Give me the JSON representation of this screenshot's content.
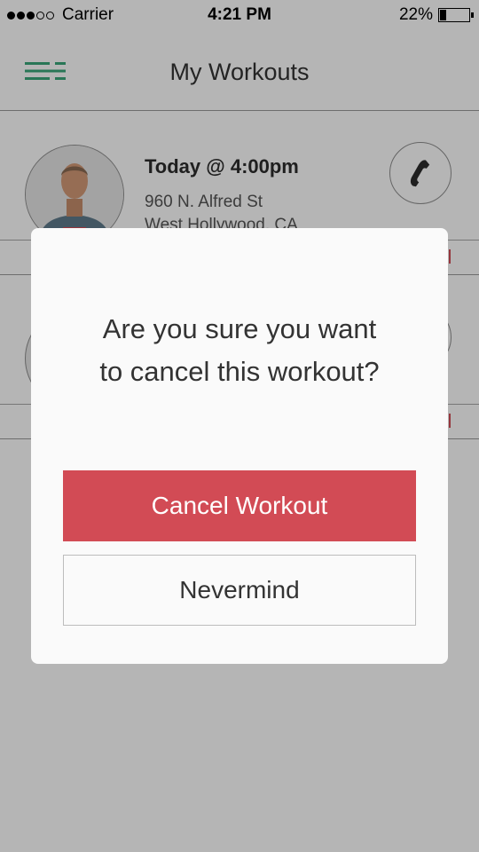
{
  "status_bar": {
    "carrier": "Carrier",
    "time": "4:21 PM",
    "battery_percent": "22%",
    "battery_level": 0.22,
    "signal_strength": 3,
    "signal_max": 5
  },
  "nav": {
    "title": "My Workouts",
    "menu_icon": "menu-icon"
  },
  "workouts": [
    {
      "title": "Today @ 4:00pm",
      "address_line1": "960 N. Alfred St",
      "address_line2": "West Hollywood, CA",
      "avatar_icon": "trainer-avatar",
      "call_icon": "phone-icon"
    },
    {
      "avatar_icon": "trainer-avatar",
      "call_icon": "phone-icon"
    }
  ],
  "dialog": {
    "message_line1": "Are you sure you want",
    "message_line2": "to cancel this workout?",
    "confirm_label": "Cancel Workout",
    "dismiss_label": "Nevermind"
  },
  "colors": {
    "accent_green": "#3aa77a",
    "cancel_red": "#d24b55",
    "overlay": "rgba(0,0,0,0.29)"
  }
}
